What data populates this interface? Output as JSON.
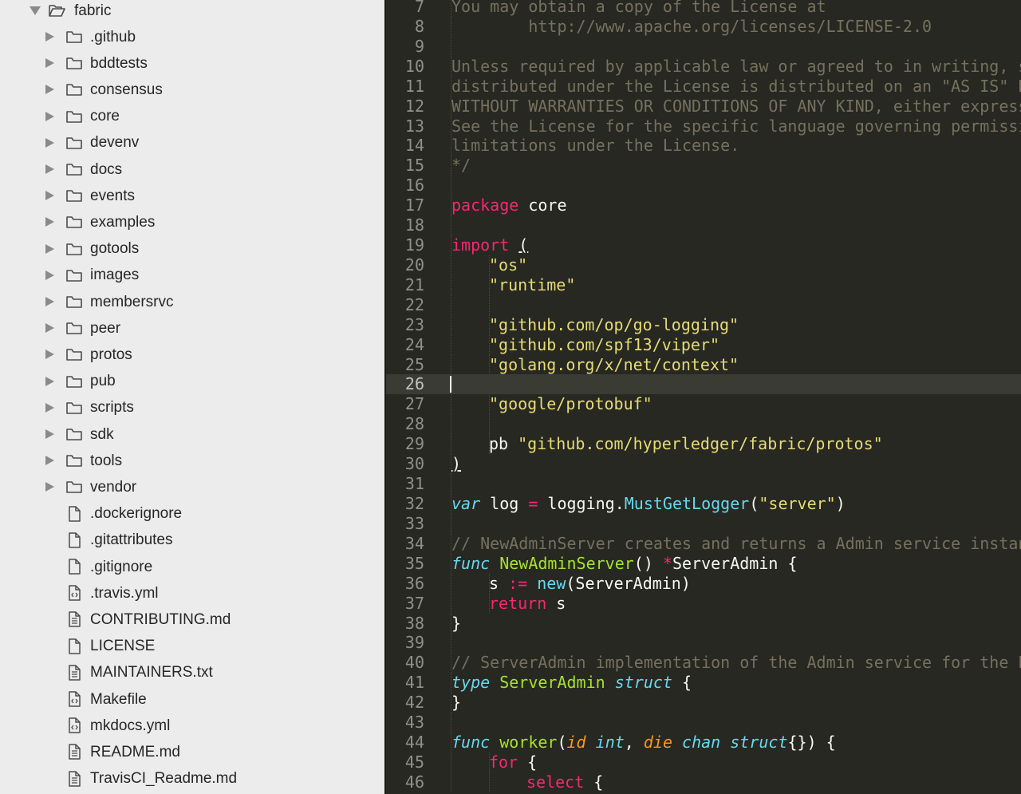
{
  "sidebar": {
    "root": {
      "label": "fabric",
      "icon": "folder-open-icon"
    },
    "items": [
      {
        "label": ".github",
        "type": "folder",
        "icon": "folder-icon"
      },
      {
        "label": "bddtests",
        "type": "folder",
        "icon": "folder-icon"
      },
      {
        "label": "consensus",
        "type": "folder",
        "icon": "folder-icon"
      },
      {
        "label": "core",
        "type": "folder",
        "icon": "folder-icon"
      },
      {
        "label": "devenv",
        "type": "folder",
        "icon": "folder-icon"
      },
      {
        "label": "docs",
        "type": "folder",
        "icon": "folder-icon"
      },
      {
        "label": "events",
        "type": "folder",
        "icon": "folder-icon"
      },
      {
        "label": "examples",
        "type": "folder",
        "icon": "folder-icon"
      },
      {
        "label": "gotools",
        "type": "folder",
        "icon": "folder-icon"
      },
      {
        "label": "images",
        "type": "folder",
        "icon": "folder-icon"
      },
      {
        "label": "membersrvc",
        "type": "folder",
        "icon": "folder-icon"
      },
      {
        "label": "peer",
        "type": "folder",
        "icon": "folder-icon"
      },
      {
        "label": "protos",
        "type": "folder",
        "icon": "folder-icon"
      },
      {
        "label": "pub",
        "type": "folder",
        "icon": "folder-icon"
      },
      {
        "label": "scripts",
        "type": "folder",
        "icon": "folder-icon"
      },
      {
        "label": "sdk",
        "type": "folder",
        "icon": "folder-icon"
      },
      {
        "label": "tools",
        "type": "folder",
        "icon": "folder-icon"
      },
      {
        "label": "vendor",
        "type": "folder",
        "icon": "folder-icon"
      },
      {
        "label": ".dockerignore",
        "type": "file",
        "icon": "file-icon"
      },
      {
        "label": ".gitattributes",
        "type": "file",
        "icon": "file-icon"
      },
      {
        "label": ".gitignore",
        "type": "file",
        "icon": "file-icon"
      },
      {
        "label": ".travis.yml",
        "type": "file",
        "icon": "code-file-icon"
      },
      {
        "label": "CONTRIBUTING.md",
        "type": "file",
        "icon": "text-file-icon"
      },
      {
        "label": "LICENSE",
        "type": "file",
        "icon": "file-icon"
      },
      {
        "label": "MAINTAINERS.txt",
        "type": "file",
        "icon": "text-file-icon"
      },
      {
        "label": "Makefile",
        "type": "file",
        "icon": "code-file-icon"
      },
      {
        "label": "mkdocs.yml",
        "type": "file",
        "icon": "code-file-icon"
      },
      {
        "label": "README.md",
        "type": "file",
        "icon": "text-file-icon"
      },
      {
        "label": "TravisCI_Readme.md",
        "type": "file",
        "icon": "text-file-icon"
      }
    ]
  },
  "editor": {
    "active_line": 26,
    "colors": {
      "background": "#272822",
      "keyword": "#f92672",
      "string": "#e6db74",
      "storage": "#66d9ef",
      "function": "#a6e22e",
      "comment": "#75715e",
      "param": "#fd971f",
      "text": "#f8f8f2"
    },
    "lines": [
      {
        "num": "7",
        "indent": 0,
        "tokens": [
          {
            "t": "You may obtain a copy of the License at",
            "c": "comment"
          }
        ]
      },
      {
        "num": "8",
        "indent": 0,
        "tokens": [
          {
            "t": "        http://www.apache.org/licenses/LICENSE-2.0",
            "c": "comment"
          }
        ]
      },
      {
        "num": "9",
        "indent": 0,
        "tokens": []
      },
      {
        "num": "10",
        "indent": 0,
        "tokens": [
          {
            "t": "Unless required by applicable law or agreed to in writing, software",
            "c": "comment"
          }
        ]
      },
      {
        "num": "11",
        "indent": 0,
        "tokens": [
          {
            "t": "distributed under the License is distributed on an \"AS IS\" BASIS,",
            "c": "comment"
          }
        ]
      },
      {
        "num": "12",
        "indent": 0,
        "tokens": [
          {
            "t": "WITHOUT WARRANTIES OR CONDITIONS OF ANY KIND, either express or implied.",
            "c": "comment"
          }
        ]
      },
      {
        "num": "13",
        "indent": 0,
        "tokens": [
          {
            "t": "See the License for the specific language governing permissions and",
            "c": "comment"
          }
        ]
      },
      {
        "num": "14",
        "indent": 0,
        "tokens": [
          {
            "t": "limitations under the License.",
            "c": "comment"
          }
        ]
      },
      {
        "num": "15",
        "indent": 0,
        "tokens": [
          {
            "t": "*/",
            "c": "comment"
          }
        ]
      },
      {
        "num": "16",
        "indent": 0,
        "tokens": []
      },
      {
        "num": "17",
        "indent": 0,
        "tokens": [
          {
            "t": "package",
            "c": "keyword"
          },
          {
            "t": " core",
            "c": "plain"
          }
        ]
      },
      {
        "num": "18",
        "indent": 0,
        "tokens": []
      },
      {
        "num": "19",
        "indent": 0,
        "tokens": [
          {
            "t": "import",
            "c": "keyword"
          },
          {
            "t": " ",
            "c": "plain"
          },
          {
            "t": "(",
            "c": "plain",
            "u": true
          }
        ]
      },
      {
        "num": "20",
        "indent": 1,
        "tokens": [
          {
            "t": "\"os\"",
            "c": "string"
          }
        ]
      },
      {
        "num": "21",
        "indent": 1,
        "tokens": [
          {
            "t": "\"runtime\"",
            "c": "string"
          }
        ]
      },
      {
        "num": "22",
        "indent": 1,
        "tokens": []
      },
      {
        "num": "23",
        "indent": 1,
        "tokens": [
          {
            "t": "\"github.com/op/go-logging\"",
            "c": "string"
          }
        ]
      },
      {
        "num": "24",
        "indent": 1,
        "tokens": [
          {
            "t": "\"github.com/spf13/viper\"",
            "c": "string"
          }
        ]
      },
      {
        "num": "25",
        "indent": 1,
        "tokens": [
          {
            "t": "\"golang.org/x/net/context\"",
            "c": "string"
          }
        ]
      },
      {
        "num": "26",
        "indent": 0,
        "tokens": []
      },
      {
        "num": "27",
        "indent": 1,
        "tokens": [
          {
            "t": "\"google/protobuf\"",
            "c": "string"
          }
        ]
      },
      {
        "num": "28",
        "indent": 1,
        "tokens": []
      },
      {
        "num": "29",
        "indent": 1,
        "tokens": [
          {
            "t": "pb ",
            "c": "plain"
          },
          {
            "t": "\"github.com/hyperledger/fabric/protos\"",
            "c": "string"
          }
        ]
      },
      {
        "num": "30",
        "indent": 0,
        "tokens": [
          {
            "t": ")",
            "c": "plain",
            "u": true
          }
        ]
      },
      {
        "num": "31",
        "indent": 0,
        "tokens": []
      },
      {
        "num": "32",
        "indent": 0,
        "tokens": [
          {
            "t": "var",
            "c": "storage"
          },
          {
            "t": " log ",
            "c": "plain"
          },
          {
            "t": "=",
            "c": "op"
          },
          {
            "t": " logging.",
            "c": "plain"
          },
          {
            "t": "MustGetLogger",
            "c": "builtin"
          },
          {
            "t": "(",
            "c": "plain"
          },
          {
            "t": "\"server\"",
            "c": "string"
          },
          {
            "t": ")",
            "c": "plain"
          }
        ]
      },
      {
        "num": "33",
        "indent": 0,
        "tokens": []
      },
      {
        "num": "34",
        "indent": 0,
        "tokens": [
          {
            "t": "// NewAdminServer creates and returns a Admin service instance.",
            "c": "comment"
          }
        ]
      },
      {
        "num": "35",
        "indent": 0,
        "tokens": [
          {
            "t": "func",
            "c": "storage"
          },
          {
            "t": " ",
            "c": "plain"
          },
          {
            "t": "NewAdminServer",
            "c": "func"
          },
          {
            "t": "() ",
            "c": "plain"
          },
          {
            "t": "*",
            "c": "op"
          },
          {
            "t": "ServerAdmin {",
            "c": "plain"
          }
        ]
      },
      {
        "num": "36",
        "indent": 1,
        "tokens": [
          {
            "t": "s ",
            "c": "plain"
          },
          {
            "t": ":=",
            "c": "op"
          },
          {
            "t": " ",
            "c": "plain"
          },
          {
            "t": "new",
            "c": "builtin"
          },
          {
            "t": "(ServerAdmin)",
            "c": "plain"
          }
        ]
      },
      {
        "num": "37",
        "indent": 1,
        "tokens": [
          {
            "t": "return",
            "c": "keyword"
          },
          {
            "t": " s",
            "c": "plain"
          }
        ]
      },
      {
        "num": "38",
        "indent": 0,
        "tokens": [
          {
            "t": "}",
            "c": "plain"
          }
        ]
      },
      {
        "num": "39",
        "indent": 0,
        "tokens": []
      },
      {
        "num": "40",
        "indent": 0,
        "tokens": [
          {
            "t": "// ServerAdmin implementation of the Admin service for the Peer",
            "c": "comment"
          }
        ]
      },
      {
        "num": "41",
        "indent": 0,
        "tokens": [
          {
            "t": "type",
            "c": "storage"
          },
          {
            "t": " ",
            "c": "plain"
          },
          {
            "t": "ServerAdmin",
            "c": "func"
          },
          {
            "t": " ",
            "c": "plain"
          },
          {
            "t": "struct",
            "c": "storage"
          },
          {
            "t": " {",
            "c": "plain"
          }
        ]
      },
      {
        "num": "42",
        "indent": 0,
        "tokens": [
          {
            "t": "}",
            "c": "plain"
          }
        ]
      },
      {
        "num": "43",
        "indent": 0,
        "tokens": []
      },
      {
        "num": "44",
        "indent": 0,
        "tokens": [
          {
            "t": "func",
            "c": "storage"
          },
          {
            "t": " ",
            "c": "plain"
          },
          {
            "t": "worker",
            "c": "func"
          },
          {
            "t": "(",
            "c": "plain"
          },
          {
            "t": "id",
            "c": "param"
          },
          {
            "t": " ",
            "c": "plain"
          },
          {
            "t": "int",
            "c": "storage"
          },
          {
            "t": ", ",
            "c": "plain"
          },
          {
            "t": "die",
            "c": "param"
          },
          {
            "t": " ",
            "c": "plain"
          },
          {
            "t": "chan",
            "c": "storage"
          },
          {
            "t": " ",
            "c": "plain"
          },
          {
            "t": "struct",
            "c": "storage"
          },
          {
            "t": "{}) {",
            "c": "plain"
          }
        ]
      },
      {
        "num": "45",
        "indent": 1,
        "tokens": [
          {
            "t": "for",
            "c": "keyword"
          },
          {
            "t": " {",
            "c": "plain"
          }
        ]
      },
      {
        "num": "46",
        "indent": 2,
        "tokens": [
          {
            "t": "select",
            "c": "keyword"
          },
          {
            "t": " {",
            "c": "plain"
          }
        ]
      }
    ]
  }
}
